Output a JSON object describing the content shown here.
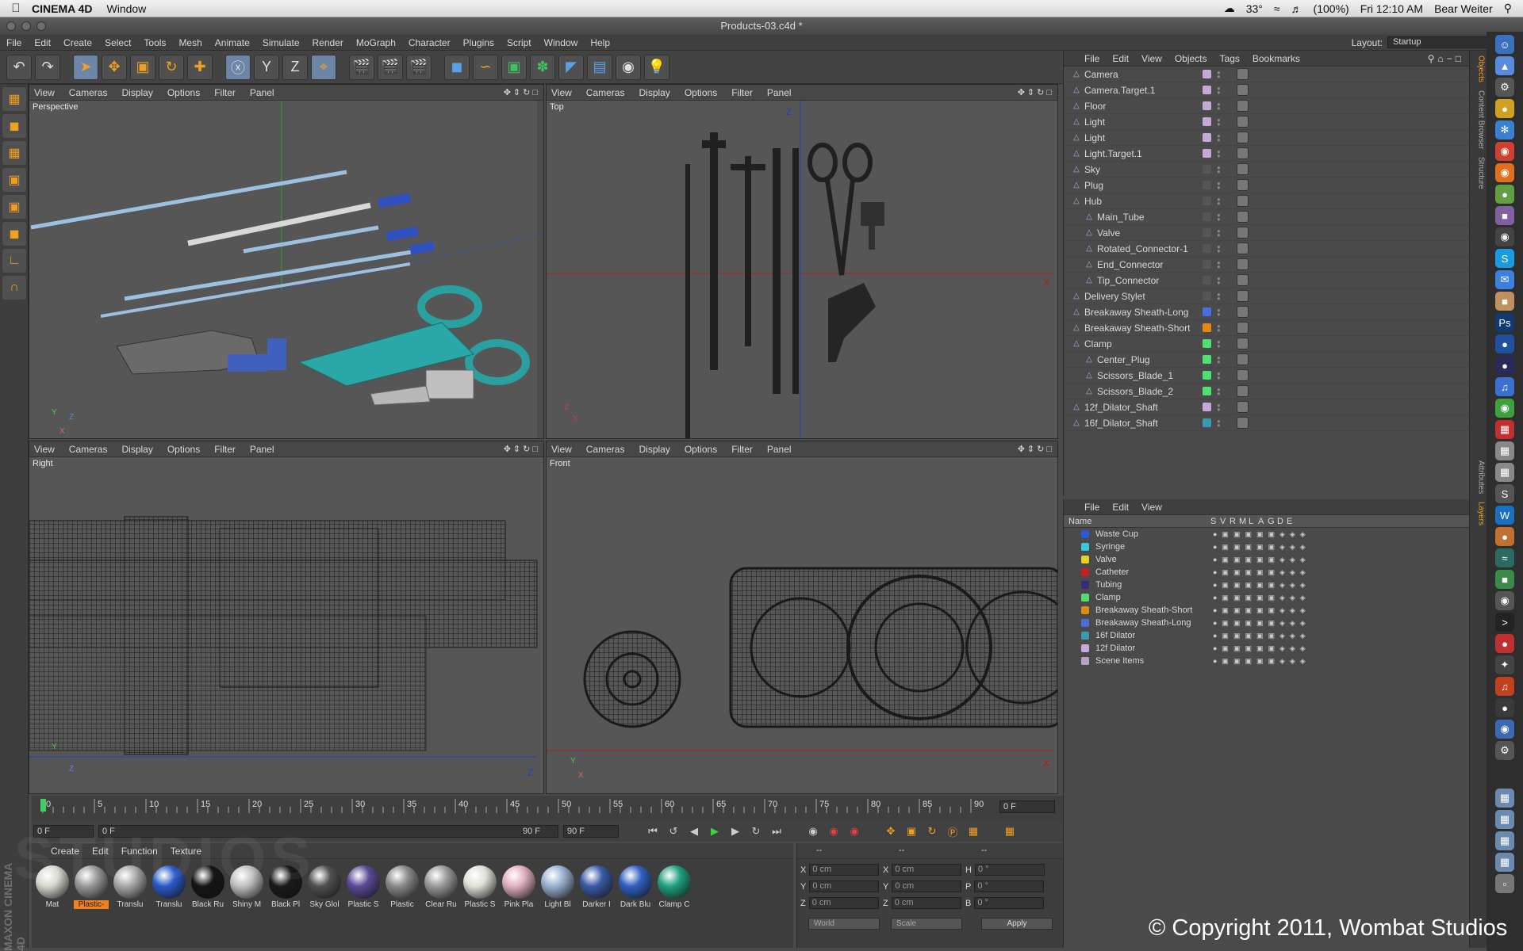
{
  "mac_menubar": {
    "app": "CINEMA 4D",
    "items": [
      "Window"
    ],
    "status": {
      "temp": "33°",
      "battery": "(100%)",
      "clock": "Fri 12:10 AM",
      "user": "Bear Weiter"
    }
  },
  "window": {
    "title": "Products-03.c4d *"
  },
  "app_menu": {
    "items": [
      "File",
      "Edit",
      "Create",
      "Select",
      "Tools",
      "Mesh",
      "Animate",
      "Simulate",
      "Render",
      "MoGraph",
      "Character",
      "Plugins",
      "Script",
      "Window",
      "Help"
    ],
    "layout_label": "Layout:",
    "layout_value": "Startup"
  },
  "viewport_menu": [
    "View",
    "Cameras",
    "Display",
    "Options",
    "Filter",
    "Panel"
  ],
  "viewports": {
    "perspective": "Perspective",
    "top": "Top",
    "right": "Right",
    "front": "Front"
  },
  "axis_labels": {
    "x": "X",
    "y": "Y",
    "z": "Z"
  },
  "object_manager": {
    "menu": [
      "File",
      "Edit",
      "View",
      "Objects",
      "Tags",
      "Bookmarks"
    ],
    "objects": [
      {
        "name": "Camera",
        "indent": 0,
        "color": "#c8a8d8"
      },
      {
        "name": "Camera.Target.1",
        "indent": 0,
        "color": "#c8a8d8"
      },
      {
        "name": "Floor",
        "indent": 0,
        "color": "#c8a8d8"
      },
      {
        "name": "Light",
        "indent": 0,
        "color": "#c8a8d8"
      },
      {
        "name": "Light",
        "indent": 0,
        "color": "#c8a8d8"
      },
      {
        "name": "Light.Target.1",
        "indent": 0,
        "color": "#c8a8d8"
      },
      {
        "name": "Sky",
        "indent": 0,
        "color": ""
      },
      {
        "name": "Plug",
        "indent": 0,
        "color": ""
      },
      {
        "name": "Hub",
        "indent": 0,
        "color": ""
      },
      {
        "name": "Main_Tube",
        "indent": 1,
        "color": ""
      },
      {
        "name": "Valve",
        "indent": 1,
        "color": ""
      },
      {
        "name": "Rotated_Connector-1",
        "indent": 1,
        "color": ""
      },
      {
        "name": "End_Connector",
        "indent": 1,
        "color": ""
      },
      {
        "name": "Tip_Connector",
        "indent": 1,
        "color": ""
      },
      {
        "name": "Delivery Stylet",
        "indent": 0,
        "color": ""
      },
      {
        "name": "Breakaway Sheath-Long",
        "indent": 0,
        "color": "#4a6ee0"
      },
      {
        "name": "Breakaway Sheath-Short",
        "indent": 0,
        "color": "#e08a10"
      },
      {
        "name": "Clamp",
        "indent": 0,
        "color": "#50e070"
      },
      {
        "name": "Center_Plug",
        "indent": 1,
        "color": "#50e070"
      },
      {
        "name": "Scissors_Blade_1",
        "indent": 1,
        "color": "#50e070"
      },
      {
        "name": "Scissors_Blade_2",
        "indent": 1,
        "color": "#50e070"
      },
      {
        "name": "12f_Dilator_Shaft",
        "indent": 0,
        "color": "#c8a8d8"
      },
      {
        "name": "16f_Dilator_Shaft",
        "indent": 0,
        "color": "#3a9ab0"
      }
    ]
  },
  "layer_manager": {
    "menu": [
      "File",
      "Edit",
      "View"
    ],
    "columns": [
      "Name",
      "S",
      "V",
      "R",
      "M",
      "L",
      "A",
      "G",
      "D",
      "E"
    ],
    "layers": [
      {
        "name": "Waste Cup",
        "color": "#2a5ad8"
      },
      {
        "name": "Syringe",
        "color": "#38c8e0"
      },
      {
        "name": "Valve",
        "color": "#e8d020"
      },
      {
        "name": "Catheter",
        "color": "#c82020"
      },
      {
        "name": "Tubing",
        "color": "#3a2a7a"
      },
      {
        "name": "Clamp",
        "color": "#50e070"
      },
      {
        "name": "Breakaway Sheath-Short",
        "color": "#e08a10"
      },
      {
        "name": "Breakaway Sheath-Long",
        "color": "#4a6ee0"
      },
      {
        "name": "16f Dilator",
        "color": "#3a9ab0"
      },
      {
        "name": "12f Dilator",
        "color": "#c8a8d8"
      },
      {
        "name": "Scene Items",
        "color": "#b8a0c8"
      }
    ]
  },
  "side_tabs": [
    "Objects",
    "Content Browser",
    "Structure",
    "Attributes",
    "Layers"
  ],
  "timeline": {
    "ticks": [
      "0",
      "5",
      "10",
      "15",
      "20",
      "25",
      "30",
      "35",
      "40",
      "45",
      "50",
      "55",
      "60",
      "65",
      "70",
      "75",
      "80",
      "85",
      "90"
    ],
    "current_frame": "0 F",
    "start": "0 F",
    "range_start": "0 F",
    "range_end": "90 F",
    "end": "90 F"
  },
  "material_manager": {
    "menu": [
      "Create",
      "Edit",
      "Function",
      "Texture"
    ],
    "materials": [
      {
        "label": "Mat",
        "color": "#d8d8d0"
      },
      {
        "label": "Plastic-",
        "color": "#9a9a9a",
        "selected": true
      },
      {
        "label": "Translu",
        "color": "#a8a8a8"
      },
      {
        "label": "Translu",
        "color": "#2a5ac8"
      },
      {
        "label": "Black Ru",
        "color": "#151515"
      },
      {
        "label": "Shiny M",
        "color": "#c0c0c0"
      },
      {
        "label": "Black Pl",
        "color": "#1a1a1a"
      },
      {
        "label": "Sky Glol",
        "color": "#505050"
      },
      {
        "label": "Plastic S",
        "color": "#5a4a98"
      },
      {
        "label": "Plastic",
        "color": "#8a8a8a"
      },
      {
        "label": "Clear Ru",
        "color": "#9a9a9a"
      },
      {
        "label": "Plastic S",
        "color": "#e0e0d8"
      },
      {
        "label": "Pink Pla",
        "color": "#e0b0c0"
      },
      {
        "label": "Light Bl",
        "color": "#9ab0d0"
      },
      {
        "label": "Darker I",
        "color": "#3a5aa8"
      },
      {
        "label": "Dark Blu",
        "color": "#3060c0"
      },
      {
        "label": "Clamp C",
        "color": "#20a080"
      }
    ]
  },
  "coordinates": {
    "headers": [
      "--",
      "--",
      "--"
    ],
    "rows": [
      {
        "a": "X",
        "av": "0 cm",
        "b": "X",
        "bv": "0 cm",
        "c": "H",
        "cv": "0 °"
      },
      {
        "a": "Y",
        "av": "0 cm",
        "b": "Y",
        "bv": "0 cm",
        "c": "P",
        "cv": "0 °"
      },
      {
        "a": "Z",
        "av": "0 cm",
        "b": "Z",
        "bv": "0 cm",
        "c": "B",
        "cv": "0 °"
      }
    ],
    "mode1": "World",
    "mode2": "Scale",
    "apply": "Apply"
  },
  "copyright": "© Copyright 2011, Wombat Studios",
  "watermark": "STUDIOS",
  "watermark_side": "MAXON CINEMA 4D"
}
